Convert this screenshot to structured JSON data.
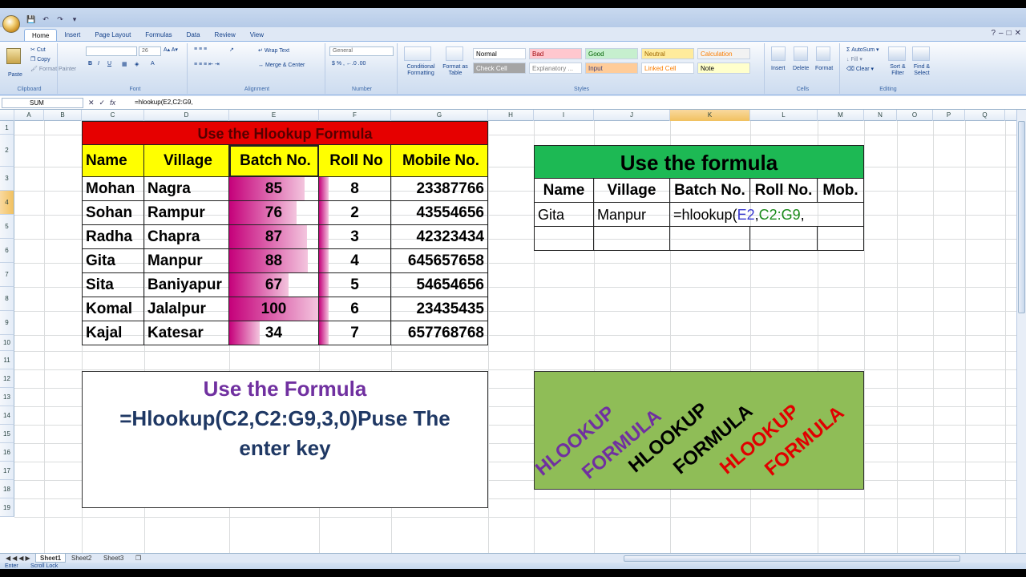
{
  "quick_access": {
    "icons": [
      "save-icon",
      "undo-icon",
      "redo-icon",
      "customize-icon"
    ]
  },
  "ribbon_tabs": [
    "Home",
    "Insert",
    "Page Layout",
    "Formulas",
    "Data",
    "Review",
    "View"
  ],
  "clipboard": {
    "paste": "Paste",
    "cut": "Cut",
    "copy": "Copy",
    "format_painter": "Format Painter",
    "title": "Clipboard"
  },
  "font": {
    "size": "26",
    "bold": "B",
    "italic": "I",
    "underline": "U",
    "title": "Font"
  },
  "alignment": {
    "wrap": "Wrap Text",
    "merge": "Merge & Center",
    "title": "Alignment"
  },
  "number": {
    "format": "General",
    "title": "Number"
  },
  "styles": {
    "conditional": "Conditional Formatting",
    "format_table": "Format as Table",
    "cells": [
      {
        "label": "Normal",
        "bg": "#ffffff",
        "color": "#000000"
      },
      {
        "label": "Bad",
        "bg": "#ffc7ce",
        "color": "#9c0006"
      },
      {
        "label": "Good",
        "bg": "#c6efce",
        "color": "#006100"
      },
      {
        "label": "Neutral",
        "bg": "#ffeb9c",
        "color": "#9c6500"
      },
      {
        "label": "Calculation",
        "bg": "#f2f2f2",
        "color": "#fa7d00"
      },
      {
        "label": "Check Cell",
        "bg": "#a5a5a5",
        "color": "#ffffff"
      },
      {
        "label": "Explanatory ...",
        "bg": "#ffffff",
        "color": "#7f7f7f"
      },
      {
        "label": "Input",
        "bg": "#ffcc99",
        "color": "#3f3f76"
      },
      {
        "label": "Linked Cell",
        "bg": "#ffffff",
        "color": "#fa7d00"
      },
      {
        "label": "Note",
        "bg": "#ffffcc",
        "color": "#000000"
      }
    ],
    "title": "Styles"
  },
  "cells_group": {
    "insert": "Insert",
    "delete": "Delete",
    "format": "Format",
    "title": "Cells"
  },
  "editing": {
    "autosum": "AutoSum",
    "fill": "Fill",
    "clear": "Clear",
    "sort": "Sort & Filter",
    "find": "Find & Select",
    "title": "Editing"
  },
  "formula_bar": {
    "name_box": "SUM",
    "formula": "=hlookup(E2,C2:G9,"
  },
  "columns": [
    "A",
    "B",
    "C",
    "D",
    "E",
    "F",
    "G",
    "H",
    "I",
    "J",
    "K",
    "L",
    "M",
    "N",
    "O",
    "P",
    "Q"
  ],
  "rows": [
    "1",
    "2",
    "3",
    "4",
    "5",
    "6",
    "7",
    "8",
    "9",
    "10",
    "11",
    "12",
    "13",
    "14",
    "15",
    "16",
    "17",
    "18",
    "19"
  ],
  "left_table": {
    "title": "Use the Hlookup Formula",
    "title_bg": "#e60000",
    "header_bg": "#ffff00",
    "headers": [
      "Name",
      "Village",
      "Batch No.",
      "Roll No",
      "Mobile No."
    ],
    "rows": [
      {
        "name": "Mohan",
        "village": "Nagra",
        "batch": "85",
        "roll": "8",
        "mobile": "23387766",
        "bar": 0.85
      },
      {
        "name": "Sohan",
        "village": "Rampur",
        "batch": "76",
        "roll": "2",
        "mobile": "43554656",
        "bar": 0.76
      },
      {
        "name": "Radha",
        "village": "Chapra",
        "batch": "87",
        "roll": "3",
        "mobile": "42323434",
        "bar": 0.87
      },
      {
        "name": "Gita",
        "village": "Manpur",
        "batch": "88",
        "roll": "4",
        "mobile": "645657658",
        "bar": 0.88
      },
      {
        "name": "Sita",
        "village": "Baniyapur",
        "batch": "67",
        "roll": "5",
        "mobile": "54654656",
        "bar": 0.67
      },
      {
        "name": "Komal",
        "village": "Jalalpur",
        "batch": "100",
        "roll": "6",
        "mobile": "23435435",
        "bar": 1.0
      },
      {
        "name": "Kajal",
        "village": "Katesar",
        "batch": "34",
        "roll": "7",
        "mobile": "657768768",
        "bar": 0.34
      }
    ]
  },
  "right_table": {
    "title": "Use the formula",
    "title_bg": "#1db954",
    "headers": [
      "Name",
      "Village",
      "Batch No.",
      "Roll No.",
      "Mob."
    ],
    "row": {
      "name": "Gita",
      "village": "Manpur",
      "formula_prefix": "=hlookup(",
      "ref1": "E2",
      "comma1": ",",
      "ref2": "C2:G9",
      "comma2": ","
    }
  },
  "instruction_box": {
    "line1": "Use the Formula",
    "line2": "=Hlookup(C2,C2:G9,3,0)Puse The",
    "line3": "enter key"
  },
  "art_box": {
    "bg": "#8fbd57",
    "words": [
      {
        "text": "HLOOKUP",
        "color": "#7030a0"
      },
      {
        "text": "FORMULA",
        "color": "#7030a0"
      },
      {
        "text": "HLOOKUP",
        "color": "#000000"
      },
      {
        "text": "FORMULA",
        "color": "#000000"
      },
      {
        "text": "HLOOKUP",
        "color": "#e00000"
      },
      {
        "text": "FORMULA",
        "color": "#e00000"
      }
    ]
  },
  "sheet_tabs": [
    "Sheet1",
    "Sheet2",
    "Sheet3"
  ],
  "status": {
    "mode": "Enter",
    "scroll_lock": "Scroll Lock"
  }
}
